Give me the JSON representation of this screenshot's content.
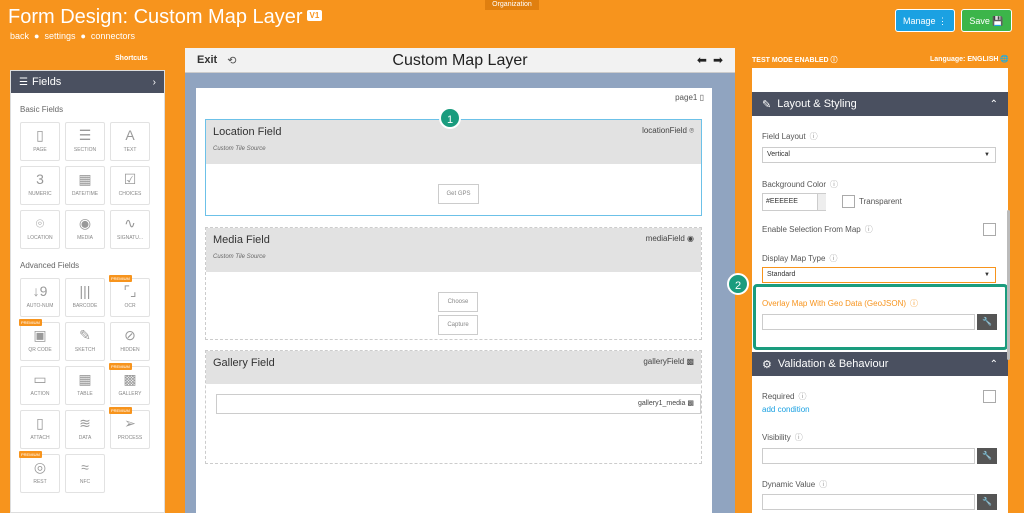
{
  "header": {
    "org_badge": "Organization",
    "title": "Form Design: Custom Map Layer",
    "version": "V1",
    "nav": [
      "back",
      "settings",
      "connectors"
    ],
    "manage_label": "Manage ⋮",
    "save_label": "Save 💾",
    "shortcuts": "Shortcuts",
    "test_mode": "TEST MODE ENABLED ⓘ",
    "language": "Language: ENGLISH 🌐"
  },
  "fields_panel": {
    "title": "Fields",
    "basic_label": "Basic Fields",
    "basic": [
      {
        "label": "PAGE",
        "icon": "▯"
      },
      {
        "label": "SECTION",
        "icon": "☰"
      },
      {
        "label": "TEXT",
        "icon": "A"
      },
      {
        "label": "NUMERIC",
        "icon": "3"
      },
      {
        "label": "DATE/TIME",
        "icon": "▦"
      },
      {
        "label": "CHOICES",
        "icon": "☑"
      },
      {
        "label": "LOCATION",
        "icon": "⌾"
      },
      {
        "label": "MEDIA",
        "icon": "◉"
      },
      {
        "label": "SIGNATU...",
        "icon": "∿"
      }
    ],
    "advanced_label": "Advanced Fields",
    "advanced": [
      {
        "label": "AUTO-NUM",
        "icon": "↓9",
        "premium": false
      },
      {
        "label": "BARCODE",
        "icon": "|||",
        "premium": false
      },
      {
        "label": "OCR",
        "icon": "⌜⌟",
        "premium": true
      },
      {
        "label": "QR CODE",
        "icon": "▣",
        "premium": true
      },
      {
        "label": "SKETCH",
        "icon": "✎",
        "premium": false
      },
      {
        "label": "HIDDEN",
        "icon": "⊘",
        "premium": false
      },
      {
        "label": "ACTION",
        "icon": "▭",
        "premium": false
      },
      {
        "label": "TABLE",
        "icon": "▦",
        "premium": false
      },
      {
        "label": "GALLERY",
        "icon": "▩",
        "premium": true
      },
      {
        "label": "ATTACH",
        "icon": "▯",
        "premium": false
      },
      {
        "label": "DATA",
        "icon": "≋",
        "premium": false
      },
      {
        "label": "PROCESS",
        "icon": "➢",
        "premium": true
      },
      {
        "label": "REST",
        "icon": "◎",
        "premium": true
      },
      {
        "label": "NFC",
        "icon": "≈",
        "premium": false
      }
    ],
    "premium_label": "PREMIUM"
  },
  "canvas": {
    "exit": "Exit",
    "title": "Custom Map Layer",
    "page_label": "page1",
    "fields": [
      {
        "name": "Location Field",
        "sub": "Custom Tile Source",
        "id": "locationField ⌾",
        "buttons": [
          "Get GPS"
        ]
      },
      {
        "name": "Media Field",
        "sub": "Custom Tile Source",
        "id": "mediaField ◉",
        "buttons": [
          "Choose",
          "Capture"
        ]
      },
      {
        "name": "Gallery Field",
        "sub": "",
        "id": "galleryField ▩",
        "box": "gallery1_media ▩"
      }
    ],
    "step1": "1",
    "step2": "2"
  },
  "properties": {
    "layout_header": "Layout & Styling",
    "field_layout_label": "Field Layout",
    "field_layout_value": "Vertical",
    "bg_color_label": "Background Color",
    "bg_color_value": "#EEEEEE",
    "transparent_label": "Transparent",
    "enable_selection_label": "Enable Selection From Map",
    "map_type_label": "Display Map Type",
    "map_type_value": "Standard",
    "overlay_label": "Overlay Map With Geo Data (GeoJSON)",
    "validation_header": "Validation & Behaviour",
    "required_label": "Required",
    "add_condition": "add condition",
    "visibility_label": "Visibility",
    "dynamic_value_label": "Dynamic Value"
  },
  "colors": {
    "brand_orange": "#f7941d",
    "header_dark": "#4a5060",
    "highlight_teal": "#1a9c7e",
    "manage_blue": "#1ba1e2",
    "save_green": "#3cb54a"
  }
}
